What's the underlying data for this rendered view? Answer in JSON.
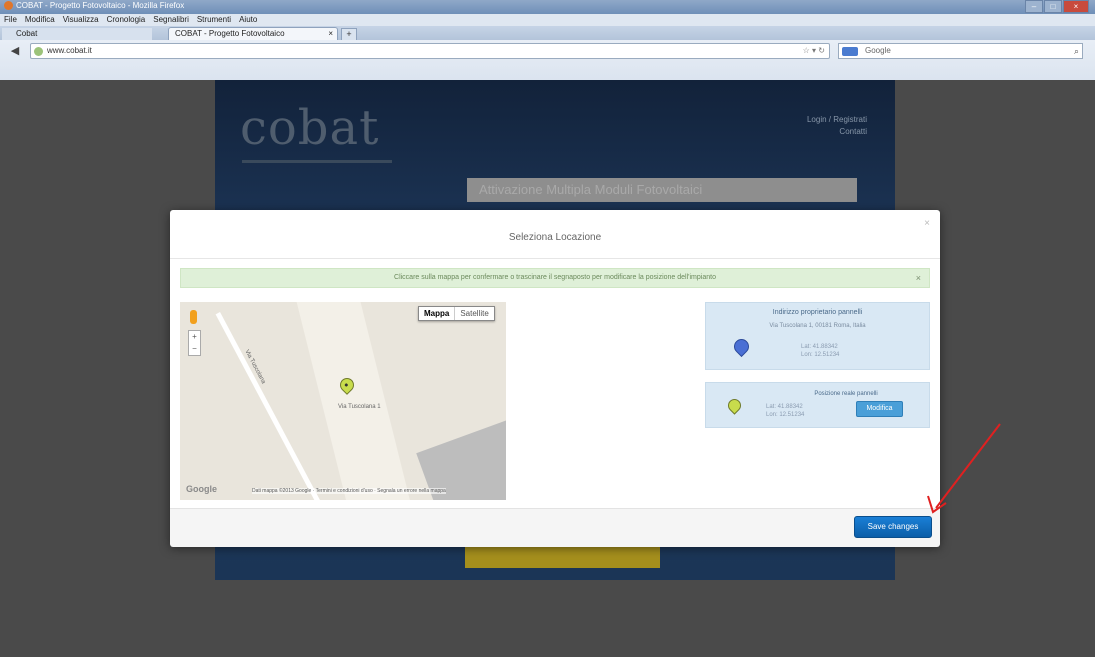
{
  "browser": {
    "title": "COBAT - Progetto Fotovoltaico - Mozilla Firefox",
    "menu": [
      "File",
      "Modifica",
      "Visualizza",
      "Cronologia",
      "Segnalibri",
      "Strumenti",
      "Aiuto"
    ],
    "app_tab_label": "Cobat",
    "tab_label": "COBAT - Progetto Fotovoltaico",
    "new_tab_label": "+",
    "url": "www.cobat.it",
    "search_placeholder": "Google",
    "window_buttons": [
      "–",
      "□",
      "×"
    ]
  },
  "site": {
    "logo": "cobat",
    "login_link_1": "Login / Registrati",
    "login_link_2": "Contatti",
    "heading": "Attivazione Multipla Moduli Fotovoltaici"
  },
  "modal": {
    "title": "Seleziona Locazione",
    "close_label": "×",
    "alert_text": "Cliccare sulla mappa per confermare o trascinare il segnaposto per modificare la posizione dell'impianto",
    "alert_close_label": "×",
    "map": {
      "type_options": [
        "Mappa",
        "Satellite"
      ],
      "selected_type": "Mappa",
      "zoom_in": "+",
      "zoom_out": "−",
      "street_label": "Via Tuscolana",
      "place_label": "Via Tuscolana 1",
      "brand": "Google",
      "attribution": "Dati mappa ©2013 Google · Termini e condizioni d'uso · Segnala un errore nella mappa"
    },
    "address_panel": {
      "title": "Indirizzo proprietario pannelli",
      "address": "Via Tuscolana 1, 00181 Roma, Italia",
      "lat": "Lat: 41.88342",
      "lon": "Lon: 12.51234"
    },
    "position_panel": {
      "title": "Posizione reale pannelli",
      "lat": "Lat: 41.88342",
      "lon": "Lon: 12.51234",
      "button_label": "Modifica"
    },
    "save_button_label": "Save changes"
  },
  "colors": {
    "primary_button": "#1a7fd6",
    "alert_bg": "#dff0d8",
    "panel_bg": "#d9e8f4",
    "annotation_arrow": "#e02020"
  }
}
